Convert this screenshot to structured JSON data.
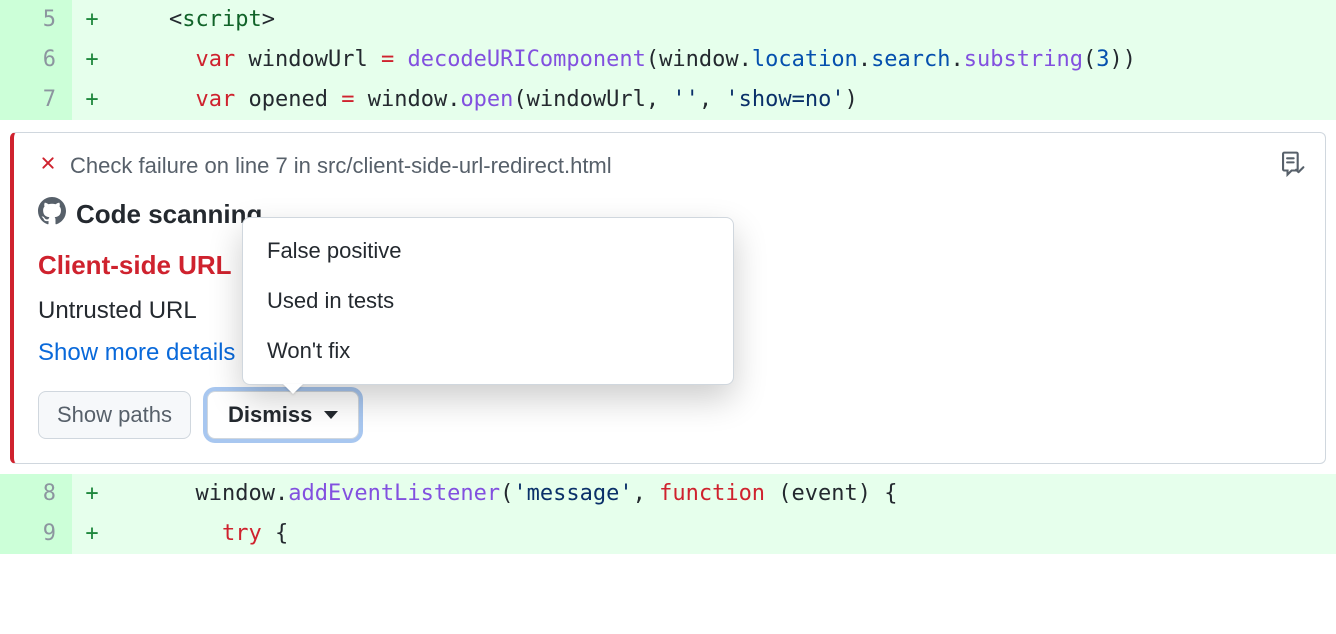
{
  "code_lines": [
    {
      "num": "5",
      "plus": "+",
      "html": "    <span class='tok-punct'>&lt;</span><span class='tok-tag'>script</span><span class='tok-punct'>&gt;</span>"
    },
    {
      "num": "6",
      "plus": "+",
      "html": "      <span class='tok-keyword'>var</span> <span class='tok-punct'>windowUrl</span> <span class='tok-keyword'>=</span> <span class='tok-func'>decodeURIComponent</span><span class='tok-punct'>(window.</span><span class='tok-var'>location</span><span class='tok-punct'>.</span><span class='tok-var'>search</span><span class='tok-punct'>.</span><span class='tok-func'>substring</span><span class='tok-punct'>(</span><span class='tok-num'>3</span><span class='tok-punct'>))</span>"
    },
    {
      "num": "7",
      "plus": "+",
      "html": "      <span class='tok-keyword'>var</span> <span class='tok-punct'>opened</span> <span class='tok-keyword'>=</span> <span class='tok-punct'>window.</span><span class='tok-func'>open</span><span class='tok-punct'>(windowUrl, </span><span class='tok-string'>''</span><span class='tok-punct'>, </span><span class='tok-string'>'show=no'</span><span class='tok-punct'>)</span>"
    }
  ],
  "code_lines_after": [
    {
      "num": "8",
      "plus": "+",
      "html": "      <span class='tok-punct'>window.</span><span class='tok-func'>addEventListener</span><span class='tok-punct'>(</span><span class='tok-string'>'message'</span><span class='tok-punct'>, </span><span class='tok-keyword'>function</span><span class='tok-punct'> (event) {</span>"
    },
    {
      "num": "9",
      "plus": "+",
      "html": "        <span class='tok-keyword'>try</span> <span class='tok-punct'>{</span>"
    }
  ],
  "alert": {
    "failure_text": "Check failure on line 7 in src/client-side-url-redirect.html",
    "scanning_label": "Code scanning",
    "title": "Client-side URL",
    "description": "Untrusted URL",
    "show_more": "Show more details",
    "show_paths": "Show paths",
    "dismiss": "Dismiss",
    "menu": [
      "False positive",
      "Used in tests",
      "Won't fix"
    ]
  }
}
